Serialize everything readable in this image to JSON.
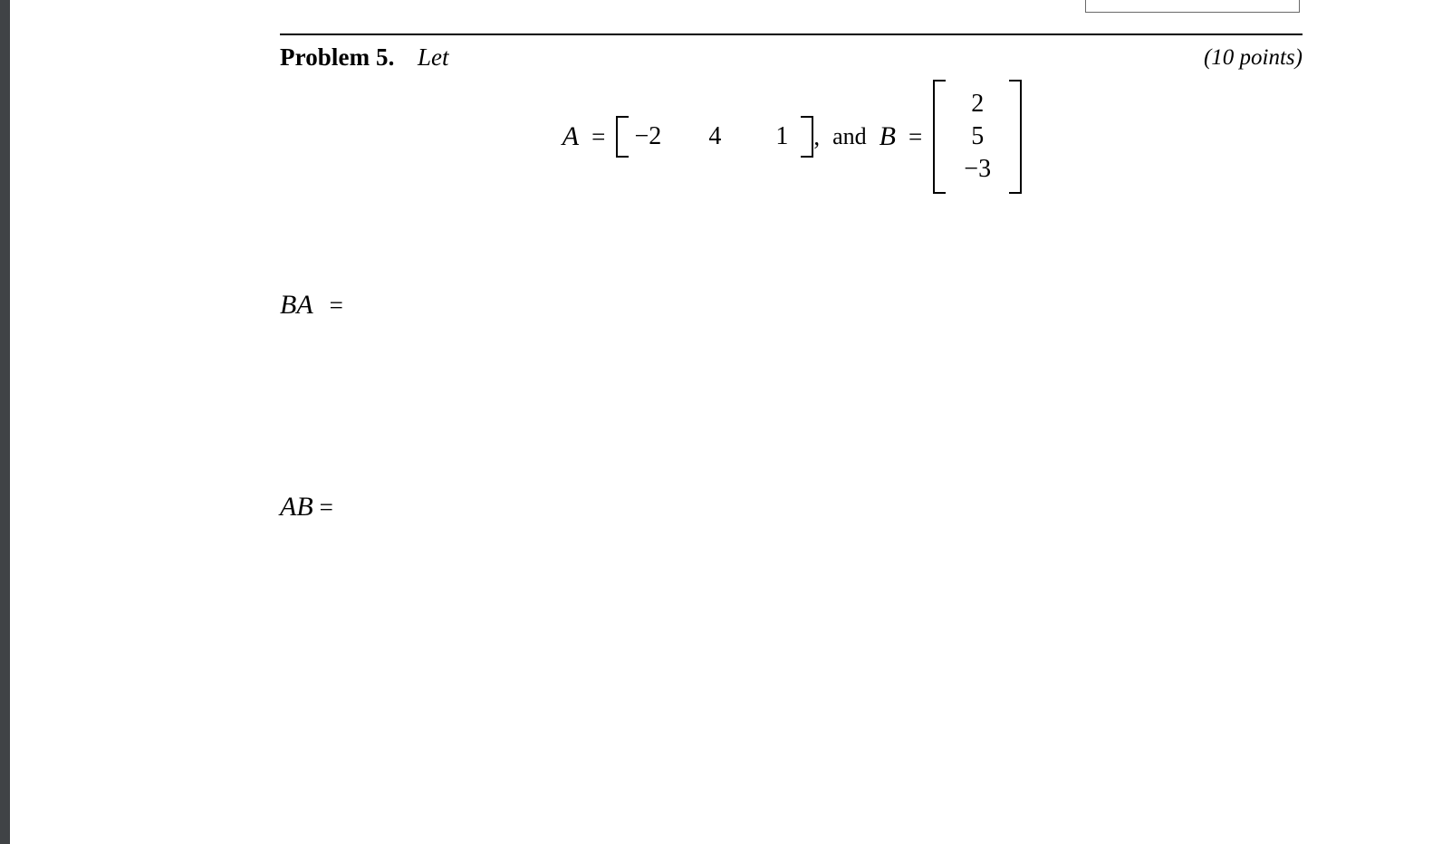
{
  "document": {
    "background_color": "#ffffff",
    "text_color": "#000000",
    "gutter_color": "#404346"
  },
  "answer_box": {
    "name": "empty-answer-box",
    "content": ""
  },
  "problem": {
    "label": "Problem 5.",
    "lead_in": "Let",
    "points": "(10 points)"
  },
  "display_math": {
    "a_symbol": "A",
    "equals": "=",
    "a_entries": [
      "−2",
      "4",
      "1"
    ],
    "comma": ",",
    "conjunction": "and",
    "b_symbol": "B",
    "equals_2": "=",
    "b_entries": [
      "2",
      "5",
      "−3"
    ]
  },
  "answers": {
    "ba": {
      "expression": "BA",
      "equals": "="
    },
    "ab": {
      "expression": "AB",
      "equals": "="
    }
  }
}
